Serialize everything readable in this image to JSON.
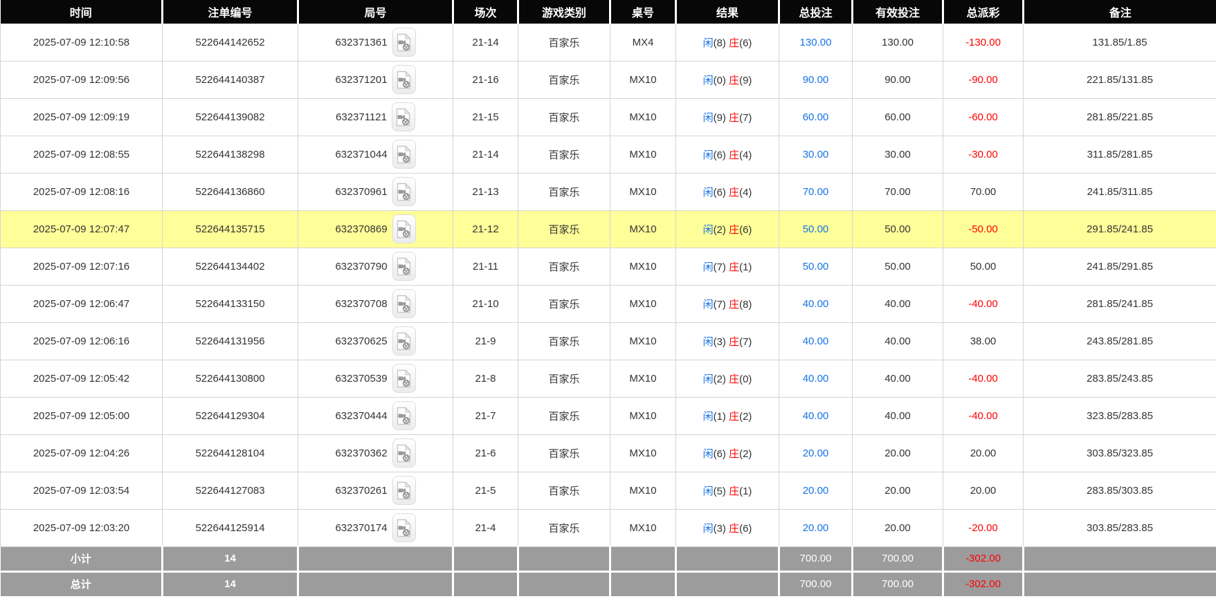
{
  "colors": {
    "accent_blue": "#1673e6",
    "accent_red": "#ff0000",
    "highlight_yellow": "#ffff99",
    "header_bg": "#070707",
    "footer_bg": "#9c9c9c"
  },
  "columns": [
    {
      "key": "time",
      "label": "时间"
    },
    {
      "key": "bet_no",
      "label": "注单编号"
    },
    {
      "key": "round_no",
      "label": "局号"
    },
    {
      "key": "session",
      "label": "场次"
    },
    {
      "key": "game_type",
      "label": "游戏类别"
    },
    {
      "key": "table_no",
      "label": "桌号"
    },
    {
      "key": "result",
      "label": "结果"
    },
    {
      "key": "total_bet",
      "label": "总投注"
    },
    {
      "key": "valid_bet",
      "label": "有效投注"
    },
    {
      "key": "payout",
      "label": "总派彩"
    },
    {
      "key": "remark",
      "label": "备注"
    }
  ],
  "result_labels": {
    "player": "闲",
    "banker": "庄"
  },
  "rows": [
    {
      "time": "2025-07-09 12:10:58",
      "bet_no": "522644142652",
      "round_no": "632371361",
      "session": "21-14",
      "game_type": "百家乐",
      "table_no": "MX4",
      "result": {
        "player": 8,
        "banker": 6
      },
      "total_bet": "130.00",
      "valid_bet": "130.00",
      "payout": "-130.00",
      "remark": "131.85/1.85",
      "highlighted": false
    },
    {
      "time": "2025-07-09 12:09:56",
      "bet_no": "522644140387",
      "round_no": "632371201",
      "session": "21-16",
      "game_type": "百家乐",
      "table_no": "MX10",
      "result": {
        "player": 0,
        "banker": 9
      },
      "total_bet": "90.00",
      "valid_bet": "90.00",
      "payout": "-90.00",
      "remark": "221.85/131.85",
      "highlighted": false
    },
    {
      "time": "2025-07-09 12:09:19",
      "bet_no": "522644139082",
      "round_no": "632371121",
      "session": "21-15",
      "game_type": "百家乐",
      "table_no": "MX10",
      "result": {
        "player": 9,
        "banker": 7
      },
      "total_bet": "60.00",
      "valid_bet": "60.00",
      "payout": "-60.00",
      "remark": "281.85/221.85",
      "highlighted": false
    },
    {
      "time": "2025-07-09 12:08:55",
      "bet_no": "522644138298",
      "round_no": "632371044",
      "session": "21-14",
      "game_type": "百家乐",
      "table_no": "MX10",
      "result": {
        "player": 6,
        "banker": 4
      },
      "total_bet": "30.00",
      "valid_bet": "30.00",
      "payout": "-30.00",
      "remark": "311.85/281.85",
      "highlighted": false
    },
    {
      "time": "2025-07-09 12:08:16",
      "bet_no": "522644136860",
      "round_no": "632370961",
      "session": "21-13",
      "game_type": "百家乐",
      "table_no": "MX10",
      "result": {
        "player": 6,
        "banker": 4
      },
      "total_bet": "70.00",
      "valid_bet": "70.00",
      "payout": "70.00",
      "remark": "241.85/311.85",
      "highlighted": false
    },
    {
      "time": "2025-07-09 12:07:47",
      "bet_no": "522644135715",
      "round_no": "632370869",
      "session": "21-12",
      "game_type": "百家乐",
      "table_no": "MX10",
      "result": {
        "player": 2,
        "banker": 6
      },
      "total_bet": "50.00",
      "valid_bet": "50.00",
      "payout": "-50.00",
      "remark": "291.85/241.85",
      "highlighted": true
    },
    {
      "time": "2025-07-09 12:07:16",
      "bet_no": "522644134402",
      "round_no": "632370790",
      "session": "21-11",
      "game_type": "百家乐",
      "table_no": "MX10",
      "result": {
        "player": 7,
        "banker": 1
      },
      "total_bet": "50.00",
      "valid_bet": "50.00",
      "payout": "50.00",
      "remark": "241.85/291.85",
      "highlighted": false
    },
    {
      "time": "2025-07-09 12:06:47",
      "bet_no": "522644133150",
      "round_no": "632370708",
      "session": "21-10",
      "game_type": "百家乐",
      "table_no": "MX10",
      "result": {
        "player": 7,
        "banker": 8
      },
      "total_bet": "40.00",
      "valid_bet": "40.00",
      "payout": "-40.00",
      "remark": "281.85/241.85",
      "highlighted": false
    },
    {
      "time": "2025-07-09 12:06:16",
      "bet_no": "522644131956",
      "round_no": "632370625",
      "session": "21-9",
      "game_type": "百家乐",
      "table_no": "MX10",
      "result": {
        "player": 3,
        "banker": 7
      },
      "total_bet": "40.00",
      "valid_bet": "40.00",
      "payout": "38.00",
      "remark": "243.85/281.85",
      "highlighted": false
    },
    {
      "time": "2025-07-09 12:05:42",
      "bet_no": "522644130800",
      "round_no": "632370539",
      "session": "21-8",
      "game_type": "百家乐",
      "table_no": "MX10",
      "result": {
        "player": 2,
        "banker": 0
      },
      "total_bet": "40.00",
      "valid_bet": "40.00",
      "payout": "-40.00",
      "remark": "283.85/243.85",
      "highlighted": false
    },
    {
      "time": "2025-07-09 12:05:00",
      "bet_no": "522644129304",
      "round_no": "632370444",
      "session": "21-7",
      "game_type": "百家乐",
      "table_no": "MX10",
      "result": {
        "player": 1,
        "banker": 2
      },
      "total_bet": "40.00",
      "valid_bet": "40.00",
      "payout": "-40.00",
      "remark": "323.85/283.85",
      "highlighted": false
    },
    {
      "time": "2025-07-09 12:04:26",
      "bet_no": "522644128104",
      "round_no": "632370362",
      "session": "21-6",
      "game_type": "百家乐",
      "table_no": "MX10",
      "result": {
        "player": 6,
        "banker": 2
      },
      "total_bet": "20.00",
      "valid_bet": "20.00",
      "payout": "20.00",
      "remark": "303.85/323.85",
      "highlighted": false
    },
    {
      "time": "2025-07-09 12:03:54",
      "bet_no": "522644127083",
      "round_no": "632370261",
      "session": "21-5",
      "game_type": "百家乐",
      "table_no": "MX10",
      "result": {
        "player": 5,
        "banker": 1
      },
      "total_bet": "20.00",
      "valid_bet": "20.00",
      "payout": "20.00",
      "remark": "283.85/303.85",
      "highlighted": false
    },
    {
      "time": "2025-07-09 12:03:20",
      "bet_no": "522644125914",
      "round_no": "632370174",
      "session": "21-4",
      "game_type": "百家乐",
      "table_no": "MX10",
      "result": {
        "player": 3,
        "banker": 6
      },
      "total_bet": "20.00",
      "valid_bet": "20.00",
      "payout": "-20.00",
      "remark": "303.85/283.85",
      "highlighted": false
    }
  ],
  "footer_rows": [
    {
      "label": "小计",
      "count": "14",
      "total_bet": "700.00",
      "valid_bet": "700.00",
      "payout": "-302.00"
    },
    {
      "label": "总计",
      "count": "14",
      "total_bet": "700.00",
      "valid_bet": "700.00",
      "payout": "-302.00"
    }
  ]
}
